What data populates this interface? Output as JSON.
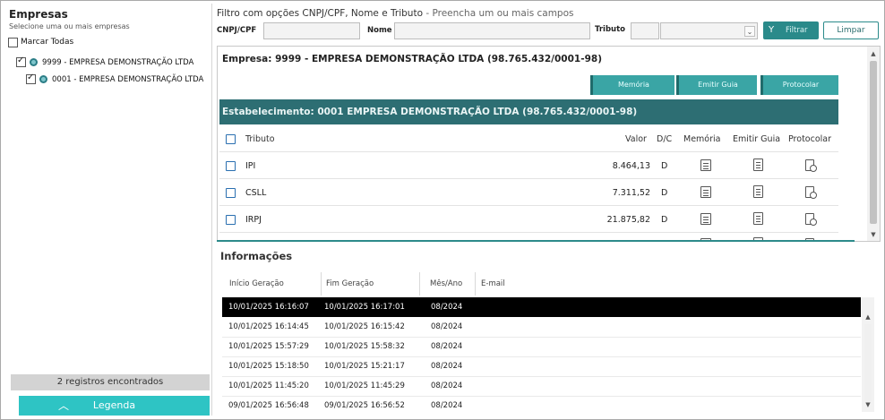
{
  "left": {
    "title": "Empresas",
    "subtitle": "Selecione uma ou mais empresas",
    "select_all": "Marcar Todas",
    "tree": [
      {
        "label": "9999 - EMPRESA DEMONSTRAÇÃO LTDA",
        "checked": true
      },
      {
        "label": "0001 - EMPRESA DEMONSTRAÇÃO LTDA",
        "checked": true
      }
    ],
    "records": "2 registros encontrados",
    "legend_button": "Legenda",
    "legend_caret": "︿"
  },
  "filter": {
    "title": "Filtro com opções CNPJ/CPF, Nome e Tributo",
    "hint": " - Preencha um ou mais campos",
    "cnpj_label": "CNPJ/CPF",
    "nome_label": "Nome",
    "tributo_label": "Tributo",
    "filtrar_button": "Filtrar",
    "limpar_button": "Limpar",
    "select_arrow": "⌄",
    "filter_icon": "Y"
  },
  "empresa": {
    "header": "Empresa: 9999 - EMPRESA DEMONSTRAÇÃO LTDA (98.765.432/0001-98)",
    "buttons": {
      "memoria": "Memória",
      "emitir_guia": "Emitir Guia",
      "protocolar": "Protocolar"
    },
    "estabelecimento": "Estabelecimento: 0001 EMPRESA DEMONSTRAÇÃO LTDA (98.765.432/0001-98)",
    "columns": {
      "tributo": "Tributo",
      "valor": "Valor",
      "dc": "D/C",
      "memoria": "Memória",
      "emitir_guia": "Emitir Guia",
      "protocolar": "Protocolar"
    },
    "rows": [
      {
        "tributo": "IPI",
        "valor": "8.464,13",
        "dc": "D"
      },
      {
        "tributo": "CSLL",
        "valor": "7.311,52",
        "dc": "D"
      },
      {
        "tributo": "IRPJ",
        "valor": "21.875,82",
        "dc": "D"
      }
    ],
    "scroll_up": "▲",
    "scroll_down": "▼"
  },
  "info": {
    "title": "Informações",
    "columns": {
      "inicio": "Início Geração",
      "fim": "Fim Geração",
      "mes": "Mês/Ano",
      "email": "E-mail"
    },
    "rows": [
      {
        "inicio": "10/01/2025 16:16:07",
        "fim": "10/01/2025 16:17:01",
        "mes": "08/2024"
      },
      {
        "inicio": "10/01/2025 16:14:45",
        "fim": "10/01/2025 16:15:42",
        "mes": "08/2024"
      },
      {
        "inicio": "10/01/2025 15:57:29",
        "fim": "10/01/2025 15:58:32",
        "mes": "08/2024"
      },
      {
        "inicio": "10/01/2025 15:18:50",
        "fim": "10/01/2025 15:21:17",
        "mes": "08/2024"
      },
      {
        "inicio": "10/01/2025 11:45:20",
        "fim": "10/01/2025 11:45:29",
        "mes": "08/2024"
      },
      {
        "inicio": "09/01/2025 16:56:48",
        "fim": "09/01/2025 16:56:52",
        "mes": "08/2024"
      }
    ],
    "scroll_up": "▲",
    "scroll_down": "▼"
  },
  "colors": {
    "teal": "#2ec4c4",
    "dark_teal": "#2d6e73",
    "button_teal": "#3aa5a5"
  }
}
